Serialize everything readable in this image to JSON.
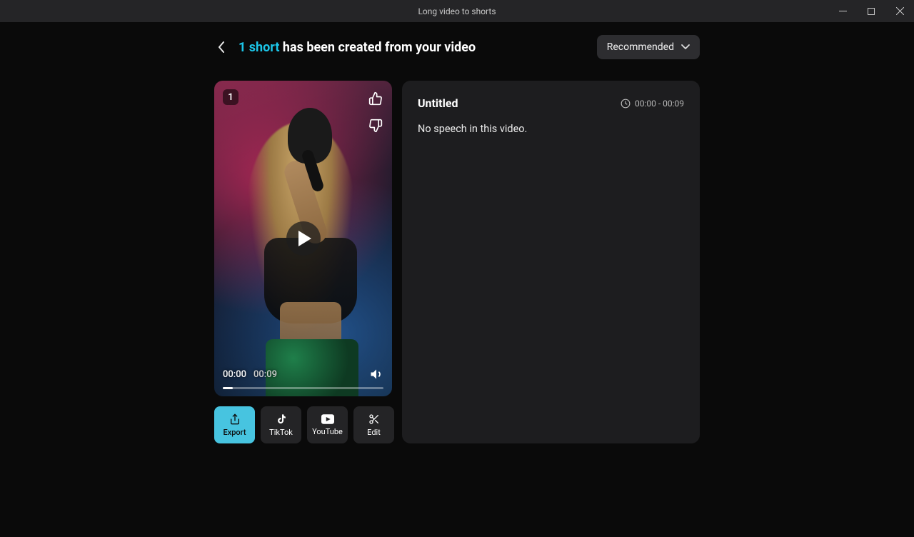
{
  "window": {
    "title": "Long video to shorts"
  },
  "header": {
    "headline_count": "1 short",
    "headline_rest": " has been created from your video",
    "dropdown_label": "Recommended"
  },
  "video": {
    "index": "1",
    "current_time": "00:00",
    "duration": "00:09",
    "progress_percent": 6
  },
  "actions": {
    "export": "Export",
    "tiktok": "TikTok",
    "youtube": "YouTube",
    "edit": "Edit"
  },
  "details": {
    "title": "Untitled",
    "time_range": "00:00 - 00:09",
    "transcript": "No speech in this video."
  }
}
